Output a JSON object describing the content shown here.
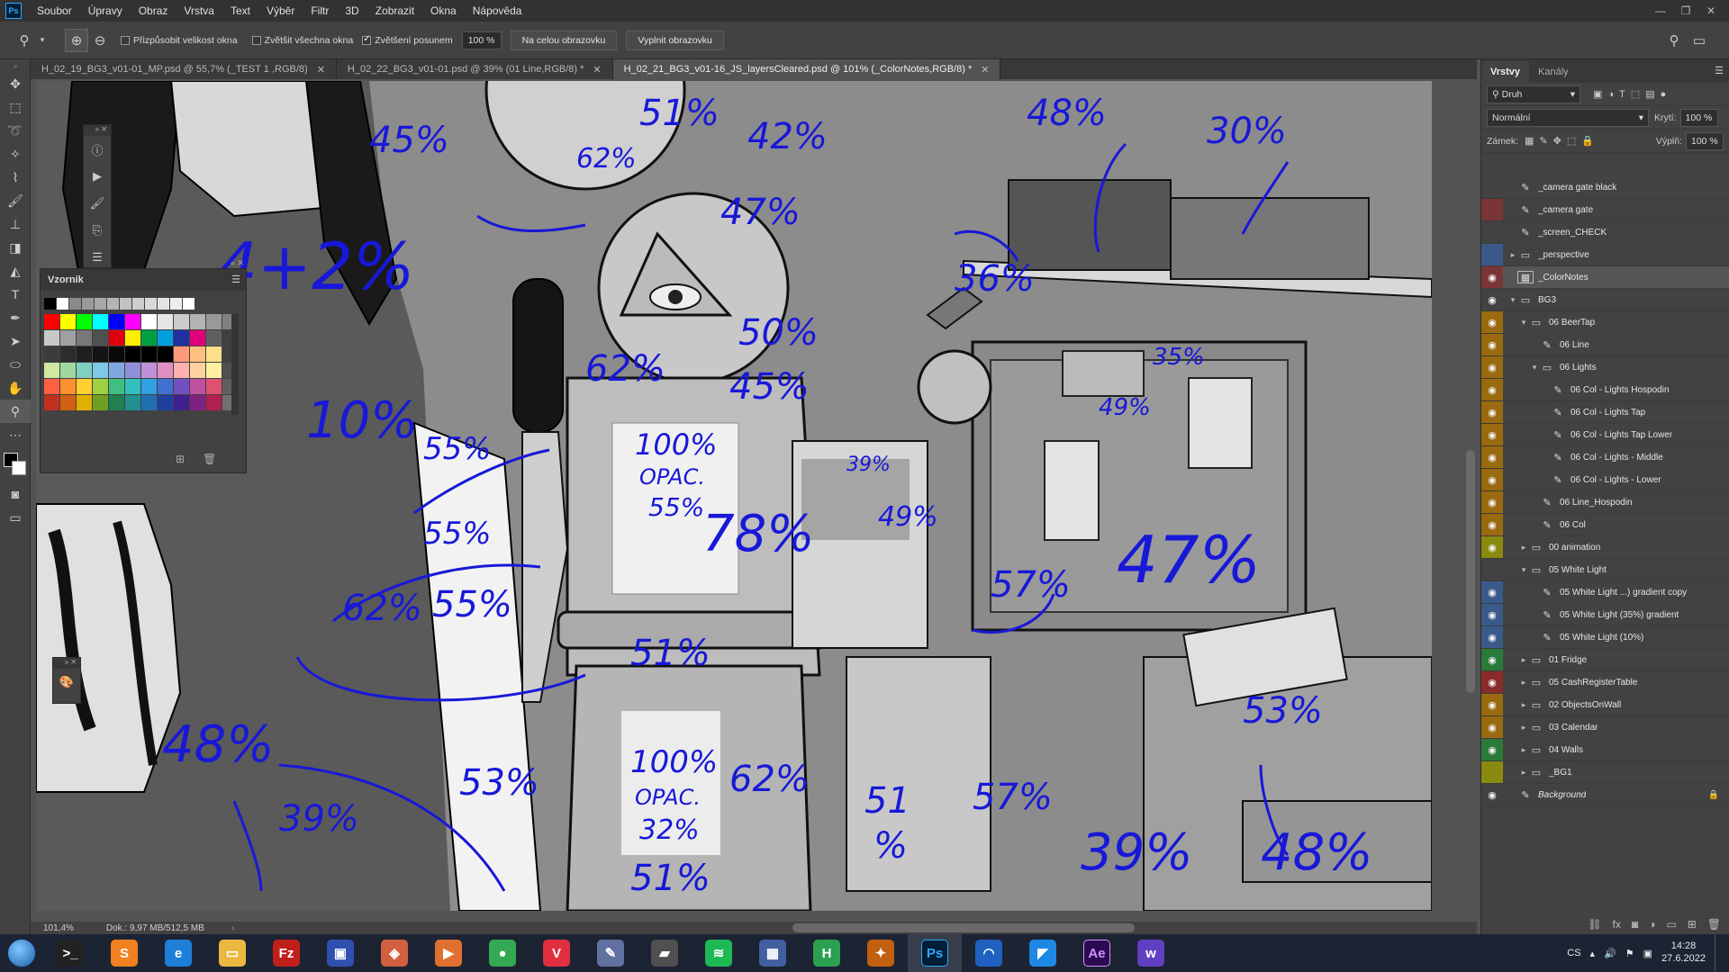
{
  "menubar": {
    "logo": "Ps",
    "items": [
      "Soubor",
      "Úpravy",
      "Obraz",
      "Vrstva",
      "Text",
      "Výběr",
      "Filtr",
      "3D",
      "Zobrazit",
      "Okna",
      "Nápověda"
    ]
  },
  "options": {
    "fit_windows": "Přizpůsobit velikost okna",
    "zoom_all": "Zvětšit všechna okna",
    "scrubby_zoom": "Zvětšení posunem",
    "zoom_value": "100 %",
    "fit_screen": "Na celou obrazovku",
    "fill_screen": "Vyplnit obrazovku"
  },
  "tabs": [
    "H_02_19_BG3_v01-01_MP.psd @ 55,7% (_TEST 1 ,RGB/8)",
    "H_02_22_BG3_v01-01.psd @ 39% (01 Line,RGB/8) *",
    "H_02_21_BG3_v01-16_JS_layersCleared.psd @ 101% (_ColorNotes,RGB/8) *"
  ],
  "swatches": {
    "title": "Vzornik",
    "basic": [
      "#000000",
      "#ffffff",
      "#8a8a8a",
      "#9a9a9a",
      "#a8a8a8",
      "#b5b5b5",
      "#c2c2c2",
      "#cecece",
      "#d9d9d9",
      "#e3e3e3",
      "#eeeeee",
      "#ffffff"
    ],
    "grid": [
      "#ff0000",
      "#ffff00",
      "#00ff00",
      "#00ffff",
      "#0000ff",
      "#ff00ff",
      "#ffffff",
      "#e6e6e6",
      "#cccccc",
      "#b3b3b3",
      "#999999",
      "#808080",
      "#c8c8c8",
      "#a0a0a0",
      "#787878",
      "#505050",
      "#e00010",
      "#ffee00",
      "#00a040",
      "#00a0e0",
      "#2030a0",
      "#e0007a",
      "#606060",
      "#404040",
      "#3c3c3c",
      "#2c2c2c",
      "#1f1f1f",
      "#141414",
      "#0a0a0a",
      "#000000",
      "#000000",
      "#000000",
      "#ff9a7a",
      "#ffc080",
      "#ffe08a",
      "#404040",
      "#d0e8a0",
      "#a0d8a0",
      "#80d0c0",
      "#80c8e8",
      "#80a8e0",
      "#9090d8",
      "#c090d8",
      "#e090c0",
      "#ffb0b0",
      "#ffd0a0",
      "#fff0a0",
      "#505050",
      "#ff6040",
      "#ff9030",
      "#ffd030",
      "#a0d040",
      "#40c080",
      "#30c0c0",
      "#30a0e0",
      "#4070d0",
      "#7050c0",
      "#c050a0",
      "#e05070",
      "#606060",
      "#c03020",
      "#d06010",
      "#e0b000",
      "#70a020",
      "#208050",
      "#209090",
      "#2070b0",
      "#2040a0",
      "#402090",
      "#802080",
      "#b02050",
      "#707070"
    ]
  },
  "canvas_notes": [
    "45%",
    "51%",
    "62%",
    "42%",
    "48%",
    "30%",
    "47%",
    "36%",
    "4+2%",
    "62%",
    "50%",
    "45%",
    "35%",
    "49%",
    "10%",
    "55%",
    "100%",
    "OPAC.",
    "55%",
    "39%",
    "49%",
    "55%",
    "78%",
    "62%",
    "55%",
    "57%",
    "47%",
    "51%",
    "48%",
    "39%",
    "53%",
    "100%",
    "OPAC.",
    "32%",
    "62%",
    "51",
    "%",
    "57%",
    "53%",
    "39%",
    "48%",
    "51%"
  ],
  "status": {
    "zoom": "101,4%",
    "doc": "Dok.: 9,97 MB/512,5 MB"
  },
  "layers_panel": {
    "tab_layers": "Vrstvy",
    "tab_channels": "Kanály",
    "filter": "Druh",
    "blend": "Normální",
    "opacity_label": "Krytí:",
    "opacity": "100 %",
    "lock_label": "Zámek:",
    "fill_label": "Výplň:",
    "fill": "100 %",
    "layers": [
      {
        "name": "_camera gate black",
        "visible": false,
        "color": "#424242",
        "indent": 0,
        "kind": "brush"
      },
      {
        "name": "_camera gate",
        "visible": false,
        "color": "#7a3535",
        "indent": 0,
        "kind": "brush"
      },
      {
        "name": "_screen_CHECK",
        "visible": false,
        "color": "#424242",
        "indent": 0,
        "kind": "brush"
      },
      {
        "name": "_perspective",
        "visible": false,
        "color": "#3a5a8a",
        "indent": 0,
        "kind": "folder-closed"
      },
      {
        "name": "_ColorNotes",
        "visible": true,
        "color": "#7a3535",
        "indent": 0,
        "kind": "thumb",
        "selected": true
      },
      {
        "name": "BG3",
        "visible": true,
        "color": "#424242",
        "indent": 0,
        "kind": "folder-open"
      },
      {
        "name": "06 BeerTap",
        "visible": true,
        "color": "#9a6a10",
        "indent": 1,
        "kind": "folder-open"
      },
      {
        "name": "06 Line",
        "visible": true,
        "color": "#9a6a10",
        "indent": 2,
        "kind": "brush"
      },
      {
        "name": "06 Lights",
        "visible": true,
        "color": "#9a6a10",
        "indent": 2,
        "kind": "folder-open"
      },
      {
        "name": "06 Col - Lights Hospodin",
        "visible": true,
        "color": "#9a6a10",
        "indent": 3,
        "kind": "brush"
      },
      {
        "name": "06 Col - Lights Tap",
        "visible": true,
        "color": "#9a6a10",
        "indent": 3,
        "kind": "brush"
      },
      {
        "name": "06 Col - Lights Tap Lower",
        "visible": true,
        "color": "#9a6a10",
        "indent": 3,
        "kind": "brush"
      },
      {
        "name": "06 Col - Lights - Middle",
        "visible": true,
        "color": "#9a6a10",
        "indent": 3,
        "kind": "brush"
      },
      {
        "name": "06 Col - Lights - Lower",
        "visible": true,
        "color": "#9a6a10",
        "indent": 3,
        "kind": "brush"
      },
      {
        "name": "06 Line_Hospodin",
        "visible": true,
        "color": "#9a6a10",
        "indent": 2,
        "kind": "brush"
      },
      {
        "name": "06 Col",
        "visible": true,
        "color": "#9a6a10",
        "indent": 2,
        "kind": "brush"
      },
      {
        "name": "00 animation",
        "visible": true,
        "color": "#8a8a10",
        "indent": 1,
        "kind": "folder-closed"
      },
      {
        "name": "05 White Light",
        "visible": false,
        "color": "#424242",
        "indent": 1,
        "kind": "folder-open"
      },
      {
        "name": "05 White Light ...) gradient copy",
        "visible": true,
        "color": "#3a5a8a",
        "indent": 2,
        "kind": "brush"
      },
      {
        "name": "05 White Light (35%) gradient",
        "visible": true,
        "color": "#3a5a8a",
        "indent": 2,
        "kind": "brush"
      },
      {
        "name": "05 White Light (10%)",
        "visible": true,
        "color": "#3a5a8a",
        "indent": 2,
        "kind": "brush"
      },
      {
        "name": "01 Fridge",
        "visible": true,
        "color": "#2a7a3a",
        "indent": 1,
        "kind": "folder-closed"
      },
      {
        "name": "05 CashRegisterTable",
        "visible": true,
        "color": "#8a2a2a",
        "indent": 1,
        "kind": "folder-closed"
      },
      {
        "name": "02 ObjectsOnWall",
        "visible": true,
        "color": "#9a6a10",
        "indent": 1,
        "kind": "folder-closed"
      },
      {
        "name": "03 Calendar",
        "visible": true,
        "color": "#9a6a10",
        "indent": 1,
        "kind": "folder-closed"
      },
      {
        "name": "04 Walls",
        "visible": true,
        "color": "#2a7a3a",
        "indent": 1,
        "kind": "folder-closed"
      },
      {
        "name": "_BG1",
        "visible": false,
        "color": "#8a8a10",
        "indent": 1,
        "kind": "folder-closed"
      },
      {
        "name": "Background",
        "visible": true,
        "color": "#424242",
        "indent": 0,
        "kind": "brush",
        "locked": true
      }
    ]
  },
  "taskbar": {
    "apps": [
      {
        "name": "cmd",
        "label": ">_",
        "color": "#222222"
      },
      {
        "name": "sublime",
        "label": "S",
        "color": "#f08020"
      },
      {
        "name": "edge",
        "label": "e",
        "color": "#1e7fd8"
      },
      {
        "name": "explorer",
        "label": "▭",
        "color": "#e8b840"
      },
      {
        "name": "filezilla",
        "label": "Fz",
        "color": "#c0201a"
      },
      {
        "name": "floppy",
        "label": "▣",
        "color": "#3050b0"
      },
      {
        "name": "viewer",
        "label": "◈",
        "color": "#d06040"
      },
      {
        "name": "player",
        "label": "▶",
        "color": "#e07030"
      },
      {
        "name": "chrome",
        "label": "●",
        "color": "#34a853"
      },
      {
        "name": "vivaldi",
        "label": "V",
        "color": "#e03040"
      },
      {
        "name": "tool",
        "label": "✎",
        "color": "#6070a0"
      },
      {
        "name": "drive",
        "label": "▰",
        "color": "#505050"
      },
      {
        "name": "spotify",
        "label": "≋",
        "color": "#1db954"
      },
      {
        "name": "calculator",
        "label": "▦",
        "color": "#4060a0"
      },
      {
        "name": "h-app",
        "label": "H",
        "color": "#2aa050"
      },
      {
        "name": "butterfly",
        "label": "✦",
        "color": "#c06010"
      },
      {
        "name": "photoshop",
        "label": "Ps",
        "color": "#001e36",
        "active": true
      },
      {
        "name": "headset",
        "label": "◠",
        "color": "#2060c0"
      },
      {
        "name": "vscode",
        "label": "◤",
        "color": "#1e88e5"
      },
      {
        "name": "after-effects",
        "label": "Ae",
        "color": "#2a0a50"
      },
      {
        "name": "w-app",
        "label": "w",
        "color": "#6040c0"
      }
    ],
    "lang": "CS",
    "time": "14:28",
    "date": "27.6.2022"
  }
}
